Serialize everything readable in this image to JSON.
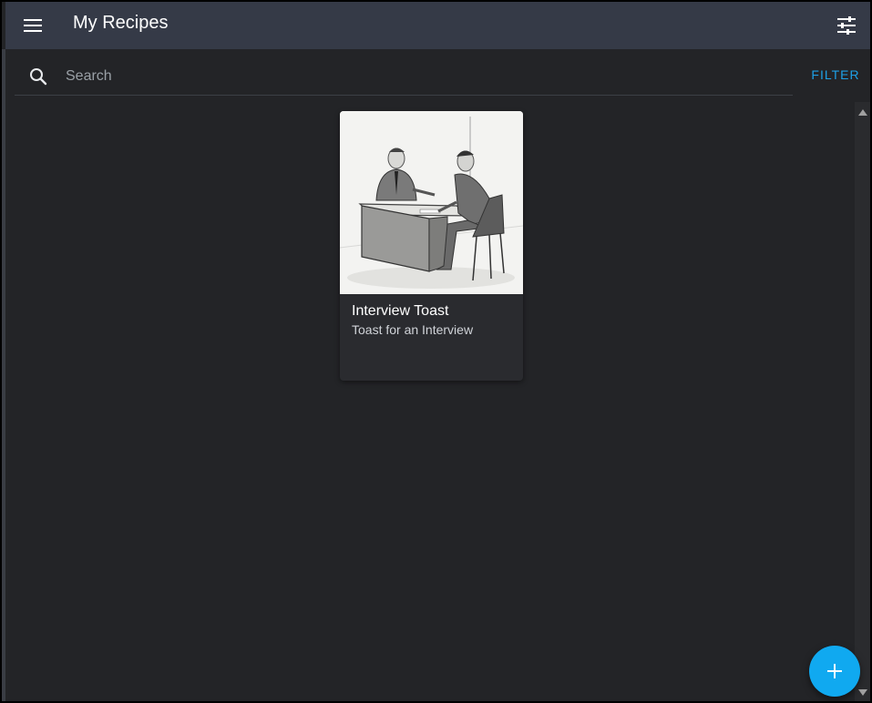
{
  "appbar": {
    "title": "My Recipes",
    "menu_icon": "menu-icon",
    "tune_icon": "tune-icon"
  },
  "search": {
    "placeholder": "Search",
    "value": "",
    "filter_label": "FILTER"
  },
  "recipes": [
    {
      "title": "Interview Toast",
      "subtitle": "Toast for an Interview",
      "image": "two-men-interview-sketch"
    }
  ],
  "fab": {
    "icon": "plus-icon"
  },
  "colors": {
    "appbar": "#353a47",
    "background": "#232427",
    "accent": "#10a9f0",
    "filter": "#1ea0e6"
  }
}
